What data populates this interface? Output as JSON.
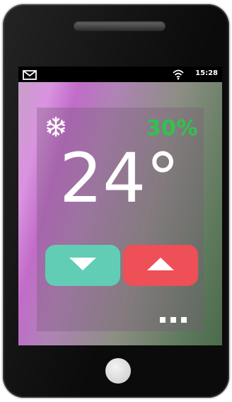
{
  "status_bar": {
    "mail_icon": "mail-icon",
    "wifi_icon": "wifi-icon",
    "time": "15:28"
  },
  "thermostat": {
    "mode_icon": "snowflake-icon",
    "humidity": "30%",
    "temperature": "24°",
    "decrease_icon": "triangle-down-icon",
    "increase_icon": "triangle-up-icon",
    "more_icon": "more-dots-icon"
  },
  "colors": {
    "humidity_text": "#2ec44c",
    "decrease_button": "#62cdb5",
    "increase_button": "#ef4f57",
    "status_bar": "#000000"
  }
}
